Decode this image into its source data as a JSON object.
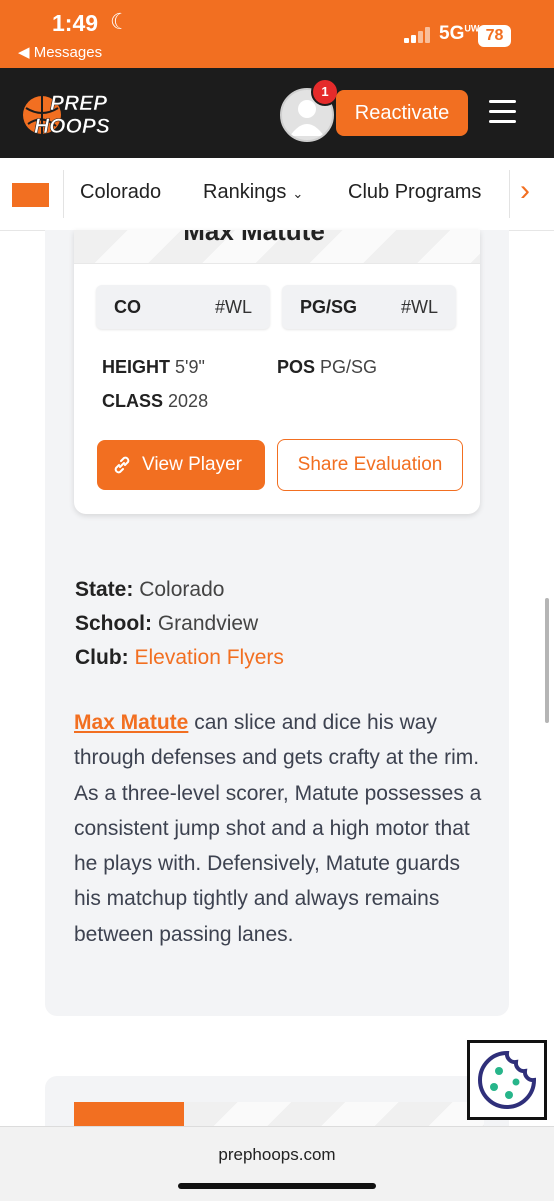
{
  "status": {
    "time": "1:49",
    "back_label": "◀ Messages",
    "network": "5G",
    "network_sup": "UW",
    "battery": "78"
  },
  "header": {
    "notification_count": "1",
    "reactivate_label": "Reactivate"
  },
  "nav": {
    "items": [
      "Colorado",
      "Rankings",
      "Club Programs"
    ]
  },
  "card": {
    "player_name": "Max Matute",
    "chips": [
      {
        "label": "CO",
        "value": "#WL"
      },
      {
        "label": "PG/SG",
        "value": "#WL"
      }
    ],
    "height_label": "HEIGHT",
    "height_value": "5'9\"",
    "pos_label": "POS",
    "pos_value": "PG/SG",
    "class_label": "CLASS",
    "class_value": "2028",
    "view_player_label": "View Player",
    "share_label": "Share Evaluation"
  },
  "info": {
    "state_label": "State:",
    "state_value": "Colorado",
    "school_label": "School:",
    "school_value": "Grandview",
    "club_label": "Club:",
    "club_value": "Elevation Flyers"
  },
  "evaluation": {
    "player_link": "Max Matute",
    "text": " can slice and dice his way through defenses and gets crafty at the rim. As a three-level scorer, Matute possesses a consistent jump shot and a high motor that he plays with. Defensively, Matute guards his matchup tightly and always remains between passing lanes."
  },
  "browser": {
    "url": "prephoops.com"
  },
  "colors": {
    "accent": "#f26f21",
    "header_bg": "#1c1c1c"
  }
}
